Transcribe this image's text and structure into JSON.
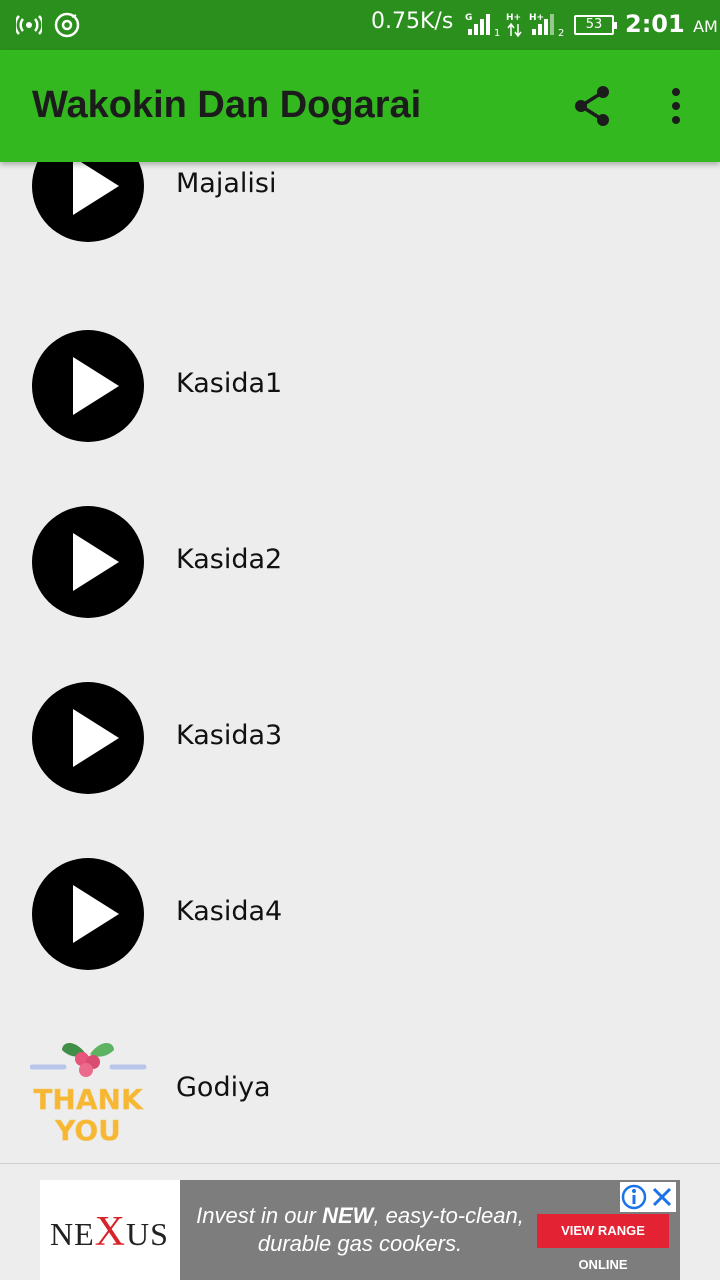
{
  "status_bar": {
    "speed": "0.75K/s",
    "network1_label": "G",
    "network2_label": "H+",
    "network3_label": "H+",
    "battery": "53",
    "time": "2:01",
    "ampm": "AM"
  },
  "app_bar": {
    "title": "Wakokin Dan Dogarai",
    "share_icon": "share-icon",
    "menu_icon": "more-vert-icon"
  },
  "list": {
    "items": [
      {
        "label": "Majalisi",
        "icon": "play-icon"
      },
      {
        "label": "Kasida1",
        "icon": "play-icon"
      },
      {
        "label": "Kasida2",
        "icon": "play-icon"
      },
      {
        "label": "Kasida3",
        "icon": "play-icon"
      },
      {
        "label": "Kasida4",
        "icon": "play-icon"
      },
      {
        "label": "Godiya",
        "icon": "thank-you-icon"
      }
    ],
    "thank_you_line1": "THANK",
    "thank_you_line2": "YOU"
  },
  "ad": {
    "brand_pre": "NE",
    "brand_x": "X",
    "brand_post": "US",
    "text_pre": "Invest in our ",
    "text_bold": "NEW",
    "text_post": ", easy-to-clean, durable gas cookers.",
    "cta": "VIEW RANGE ONLINE",
    "info_icon": "info-icon",
    "close_icon": "close-icon"
  },
  "colors": {
    "status_bar": "#2a8f1c",
    "app_bar": "#33b81f",
    "background": "#ededed",
    "ad_cta": "#e32333"
  }
}
